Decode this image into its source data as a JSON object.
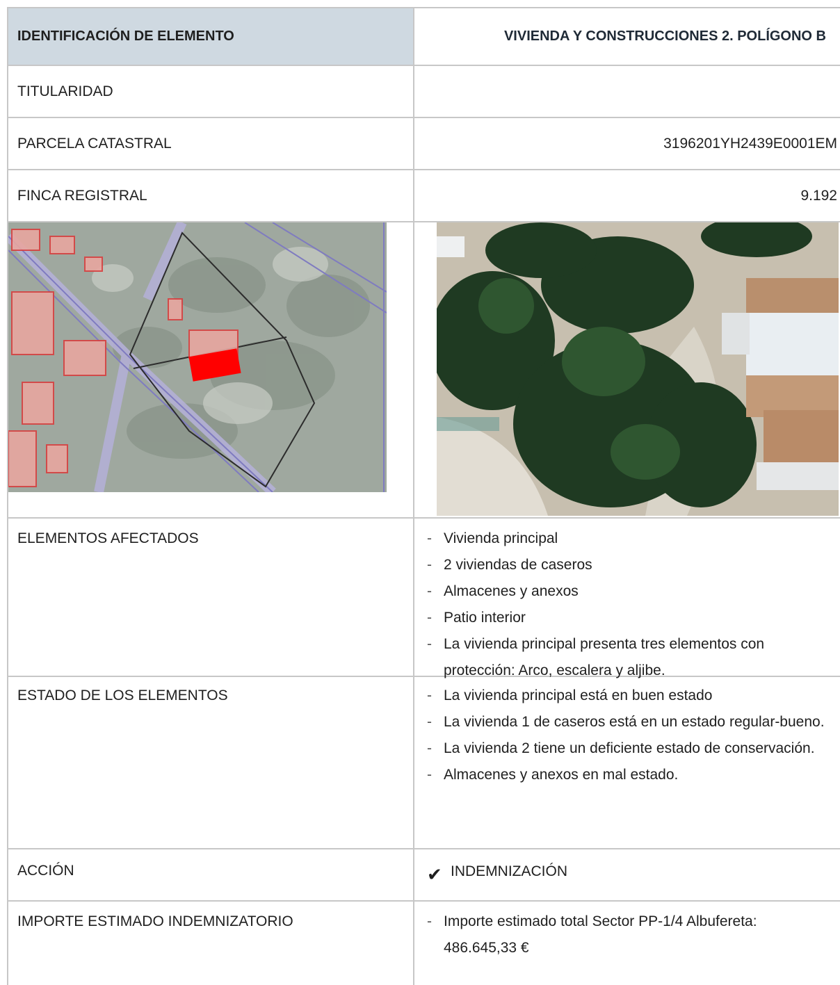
{
  "header": {
    "left": "IDENTIFICACIÓN DE ELEMENTO",
    "right": "VIVIENDA Y CONSTRUCCIONES 2. POLÍGONO B"
  },
  "titularidad": {
    "label": "TITULARIDAD",
    "value": ""
  },
  "parcela": {
    "label": "PARCELA CATASTRAL",
    "value": "3196201YH2439E0001EM"
  },
  "finca": {
    "label": "FINCA REGISTRAL",
    "value": "9.192"
  },
  "images": {
    "map_icon": "cadastral-map-image",
    "aerial_icon": "aerial-photo-image",
    "highlight_color": "#ff0000"
  },
  "elementos": {
    "label": "ELEMENTOS AFECTADOS",
    "items": [
      "Vivienda principal",
      "2 viviendas de caseros",
      "Almacenes y anexos",
      "Patio interior",
      "La vivienda principal presenta tres elementos con protección: Arco, escalera y aljibe."
    ]
  },
  "estado": {
    "label": "ESTADO DE LOS ELEMENTOS",
    "items": [
      "La vivienda principal está en buen estado",
      "La vivienda 1 de caseros está en un estado regular-bueno.",
      "La vivienda 2 tiene un deficiente estado de conservación.",
      "Almacenes y anexos en mal estado."
    ]
  },
  "accion": {
    "label": "ACCIÓN",
    "check": "✔",
    "value": "INDEMNIZACIÓN"
  },
  "importe": {
    "label": "IMPORTE ESTIMADO INDEMNIZATORIO",
    "items": [
      "Importe estimado total Sector PP-1/4 Albufereta: 486.645,33 €"
    ]
  },
  "colors": {
    "header_bg": "#cfd9e1",
    "border": "#c7c7c7"
  }
}
